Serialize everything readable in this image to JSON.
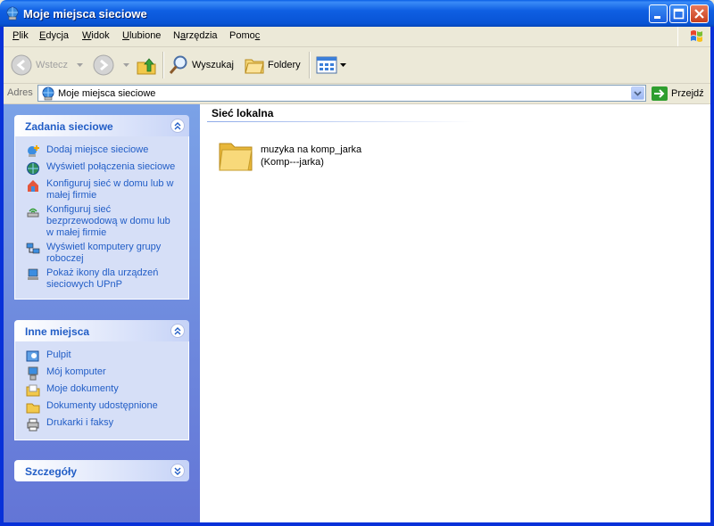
{
  "window": {
    "title": "Moje miejsca sieciowe"
  },
  "menu": [
    {
      "pre": "",
      "u": "P",
      "post": "lik"
    },
    {
      "pre": "",
      "u": "E",
      "post": "dycja"
    },
    {
      "pre": "",
      "u": "W",
      "post": "idok"
    },
    {
      "pre": "",
      "u": "U",
      "post": "lubione"
    },
    {
      "pre": "N",
      "u": "a",
      "post": "rzędzia"
    },
    {
      "pre": "Pomo",
      "u": "c",
      "post": ""
    }
  ],
  "toolbar": {
    "back_label": "Wstecz",
    "search_label": "Wyszukaj",
    "folders_label": "Foldery"
  },
  "address": {
    "label": "Adres",
    "value": "Moje miejsca sieciowe",
    "go_label": "Przejdź"
  },
  "panels": {
    "network_tasks": {
      "title": "Zadania sieciowe",
      "items": [
        [
          "Dodaj miejsce sieciowe"
        ],
        [
          "Wyświetl połączenia sieciowe"
        ],
        [
          "Konfiguruj sieć w domu lub w",
          "małej firmie"
        ],
        [
          "Konfiguruj sieć",
          "bezprzewodową w domu lub",
          "w małej firmie"
        ],
        [
          "Wyświetl komputery grupy",
          "roboczej"
        ],
        [
          "Pokaż ikony dla urządzeń",
          "sieciowych UPnP"
        ]
      ]
    },
    "other_places": {
      "title": "Inne miejsca",
      "items": [
        "Pulpit",
        "Mój komputer",
        "Moje dokumenty",
        "Dokumenty udostępnione",
        "Drukarki i faksy"
      ]
    },
    "details": {
      "title": "Szczegóły"
    }
  },
  "content": {
    "group_title": "Sieć lokalna",
    "share": {
      "line1": "muzyka na komp_jarka",
      "line2": "(Komp---jarka)"
    }
  },
  "colors": {
    "titlebar": "#0A5FE6",
    "link": "#215DC6",
    "pane": "#7BA2E7"
  }
}
